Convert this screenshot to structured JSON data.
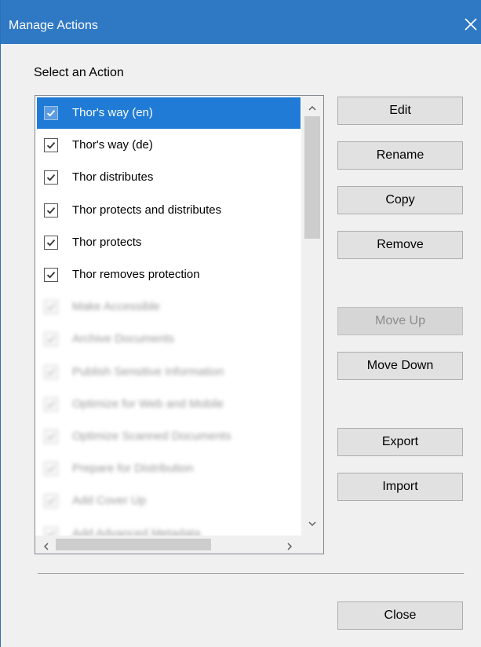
{
  "dialog": {
    "title": "Manage Actions"
  },
  "list": {
    "label": "Select an Action",
    "items": [
      {
        "label": "Thor's way (en)",
        "checked": true,
        "selected": true,
        "legible": true
      },
      {
        "label": "Thor's way (de)",
        "checked": true,
        "selected": false,
        "legible": true
      },
      {
        "label": "Thor distributes",
        "checked": true,
        "selected": false,
        "legible": true
      },
      {
        "label": "Thor protects and distributes",
        "checked": true,
        "selected": false,
        "legible": true
      },
      {
        "label": "Thor protects",
        "checked": true,
        "selected": false,
        "legible": true
      },
      {
        "label": "Thor removes protection",
        "checked": true,
        "selected": false,
        "legible": true
      },
      {
        "label": "Make Accessible",
        "checked": true,
        "selected": false,
        "legible": false
      },
      {
        "label": "Archive Documents",
        "checked": true,
        "selected": false,
        "legible": false
      },
      {
        "label": "Publish Sensitive Information",
        "checked": true,
        "selected": false,
        "legible": false
      },
      {
        "label": "Optimize for Web and Mobile",
        "checked": true,
        "selected": false,
        "legible": false
      },
      {
        "label": "Optimize Scanned Documents",
        "checked": true,
        "selected": false,
        "legible": false
      },
      {
        "label": "Prepare for Distribution",
        "checked": true,
        "selected": false,
        "legible": false
      },
      {
        "label": "Add Cover Up",
        "checked": true,
        "selected": false,
        "legible": false
      },
      {
        "label": "Add Advanced Metadata",
        "checked": true,
        "selected": false,
        "legible": false
      }
    ]
  },
  "buttons": {
    "edit": "Edit",
    "rename": "Rename",
    "copy": "Copy",
    "remove": "Remove",
    "move_up": "Move Up",
    "move_down": "Move Down",
    "export": "Export",
    "import": "Import",
    "close": "Close"
  },
  "state": {
    "move_up_enabled": false
  },
  "colors": {
    "titlebar": "#2f78c4",
    "selection": "#1f7bd6"
  }
}
